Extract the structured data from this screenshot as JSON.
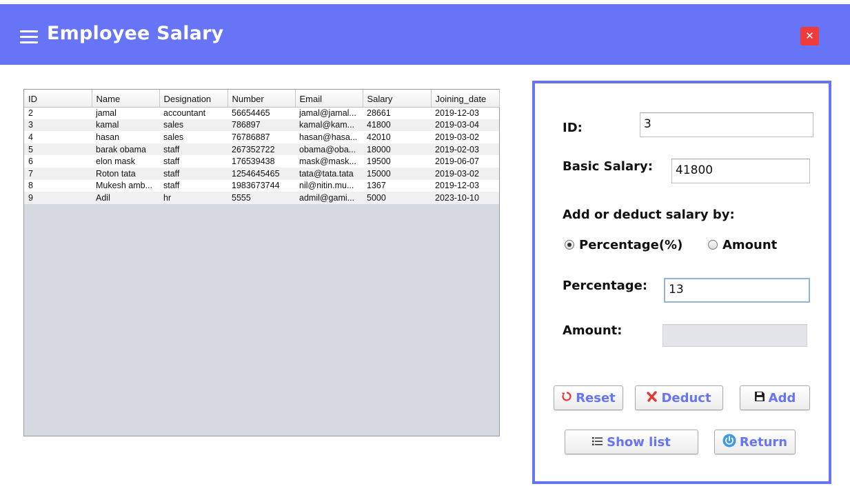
{
  "header": {
    "title": "Employee Salary",
    "close_label": "✕"
  },
  "table": {
    "columns": [
      "ID",
      "Name",
      "Designation",
      "Number",
      "Email",
      "Salary",
      "Joining_date"
    ],
    "rows": [
      [
        "2",
        "jamal",
        "accountant",
        "56654465",
        "jamal@jamal...",
        "28661",
        "2019-12-03"
      ],
      [
        "3",
        "kamal",
        "sales",
        "786897",
        "kamal@kam...",
        "41800",
        "2019-03-04"
      ],
      [
        "4",
        "hasan",
        "sales",
        "76786887",
        "hasan@hasa...",
        "42010",
        "2019-03-02"
      ],
      [
        "5",
        "barak obama",
        "staff",
        "267352722",
        "obama@oba...",
        "18000",
        "2019-02-03"
      ],
      [
        "6",
        "elon mask",
        "staff",
        "176539438",
        "mask@mask...",
        "19500",
        "2019-06-07"
      ],
      [
        "7",
        "Roton tata",
        "staff",
        "1254645465",
        "tata@tata.tata",
        "15000",
        "2019-03-02"
      ],
      [
        "8",
        "Mukesh amb...",
        "staff",
        "1983673744",
        "nil@nitin.mu...",
        "1367",
        "2019-12-03"
      ],
      [
        "9",
        "Adil",
        "hr",
        "5555",
        "admil@gami...",
        "5000",
        "2023-10-10"
      ]
    ]
  },
  "form": {
    "id_label": "ID:",
    "id_value": "3",
    "basic_salary_label": "Basic Salary:",
    "basic_salary_value": "41800",
    "mode_label": "Add or deduct salary by:",
    "radio_percentage": "Percentage(%)",
    "radio_amount": "Amount",
    "selected_mode": "percentage",
    "percentage_label": "Percentage:",
    "percentage_value": "13",
    "amount_label": "Amount:",
    "amount_value": ""
  },
  "buttons": {
    "reset": "Reset",
    "deduct": "Deduct",
    "add": "Add",
    "show_list": "Show list",
    "return": "Return"
  },
  "colors": {
    "header": "#6774f6",
    "close": "#ee3b3b",
    "button_text": "#6774f6"
  }
}
